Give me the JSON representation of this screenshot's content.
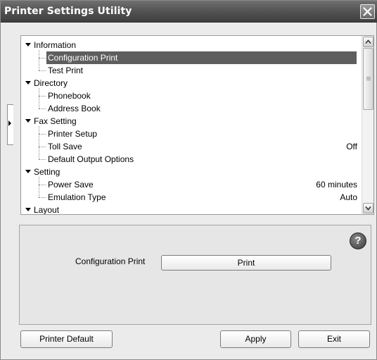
{
  "window": {
    "title": "Printer Settings Utility",
    "close_label": "close"
  },
  "tree": {
    "selected": "Configuration Print",
    "rows": [
      {
        "type": "category",
        "label": "Information"
      },
      {
        "type": "item",
        "label": "Configuration Print",
        "value": ""
      },
      {
        "type": "item",
        "label": "Test Print",
        "value": ""
      },
      {
        "type": "category",
        "label": "Directory"
      },
      {
        "type": "item",
        "label": "Phonebook",
        "value": ""
      },
      {
        "type": "item",
        "label": "Address Book",
        "value": ""
      },
      {
        "type": "category",
        "label": "Fax Setting"
      },
      {
        "type": "item",
        "label": "Printer Setup",
        "value": ""
      },
      {
        "type": "item",
        "label": "Toll Save",
        "value": "Off"
      },
      {
        "type": "item",
        "label": "Default Output Options",
        "value": ""
      },
      {
        "type": "category",
        "label": "Setting"
      },
      {
        "type": "item",
        "label": "Power Save",
        "value": "60 minutes"
      },
      {
        "type": "item",
        "label": "Emulation Type",
        "value": "Auto"
      },
      {
        "type": "category",
        "label": "Layout"
      }
    ]
  },
  "detail": {
    "label": "Configuration Print",
    "action_label": "Print",
    "help_glyph": "?"
  },
  "footer": {
    "default_label": "Printer Default",
    "apply_label": "Apply",
    "exit_label": "Exit"
  },
  "colors": {
    "title_bar": "#555555",
    "selection": "#5e5e5e",
    "panel_bg": "#e6e6e6"
  }
}
